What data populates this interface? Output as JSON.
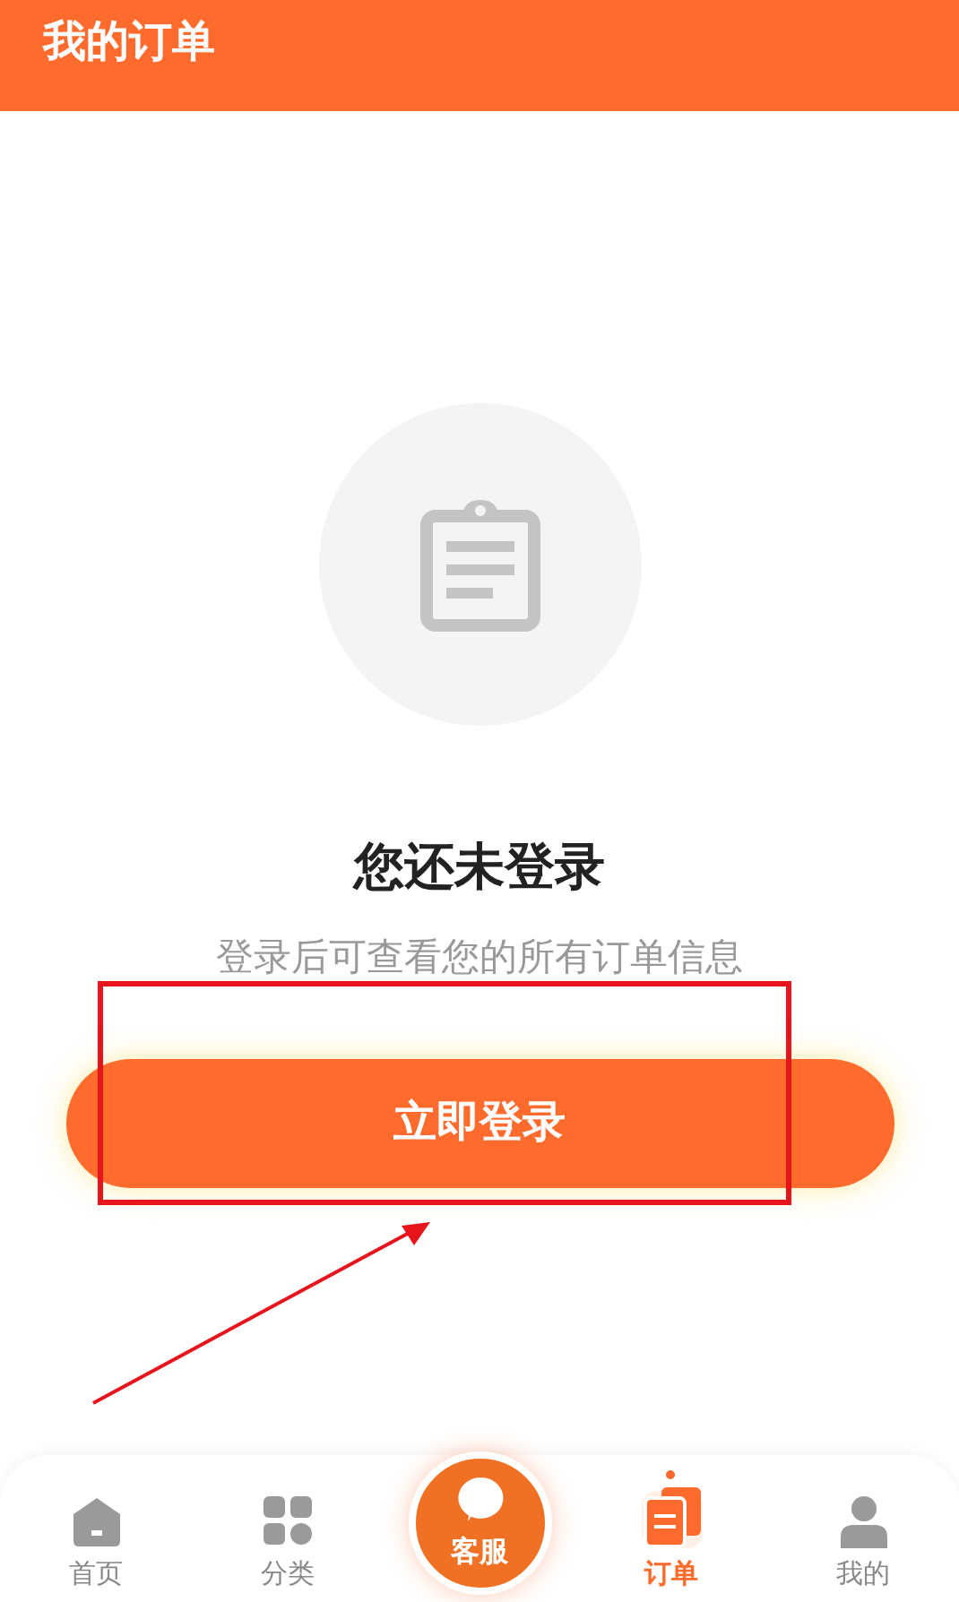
{
  "header": {
    "title": "我的订单"
  },
  "empty_state": {
    "title": "您还未登录",
    "message": "登录后可查看您的所有订单信息",
    "button": "立即登录"
  },
  "tab_bar": [
    {
      "label": "首页",
      "kind": "tab",
      "selected": false
    },
    {
      "label": "分类",
      "kind": "tab",
      "selected": false
    },
    {
      "label": "客服",
      "kind": "center",
      "selected": false
    },
    {
      "label": "订单",
      "kind": "tab",
      "selected": true
    },
    {
      "label": "我的",
      "kind": "tab",
      "selected": false
    }
  ]
}
